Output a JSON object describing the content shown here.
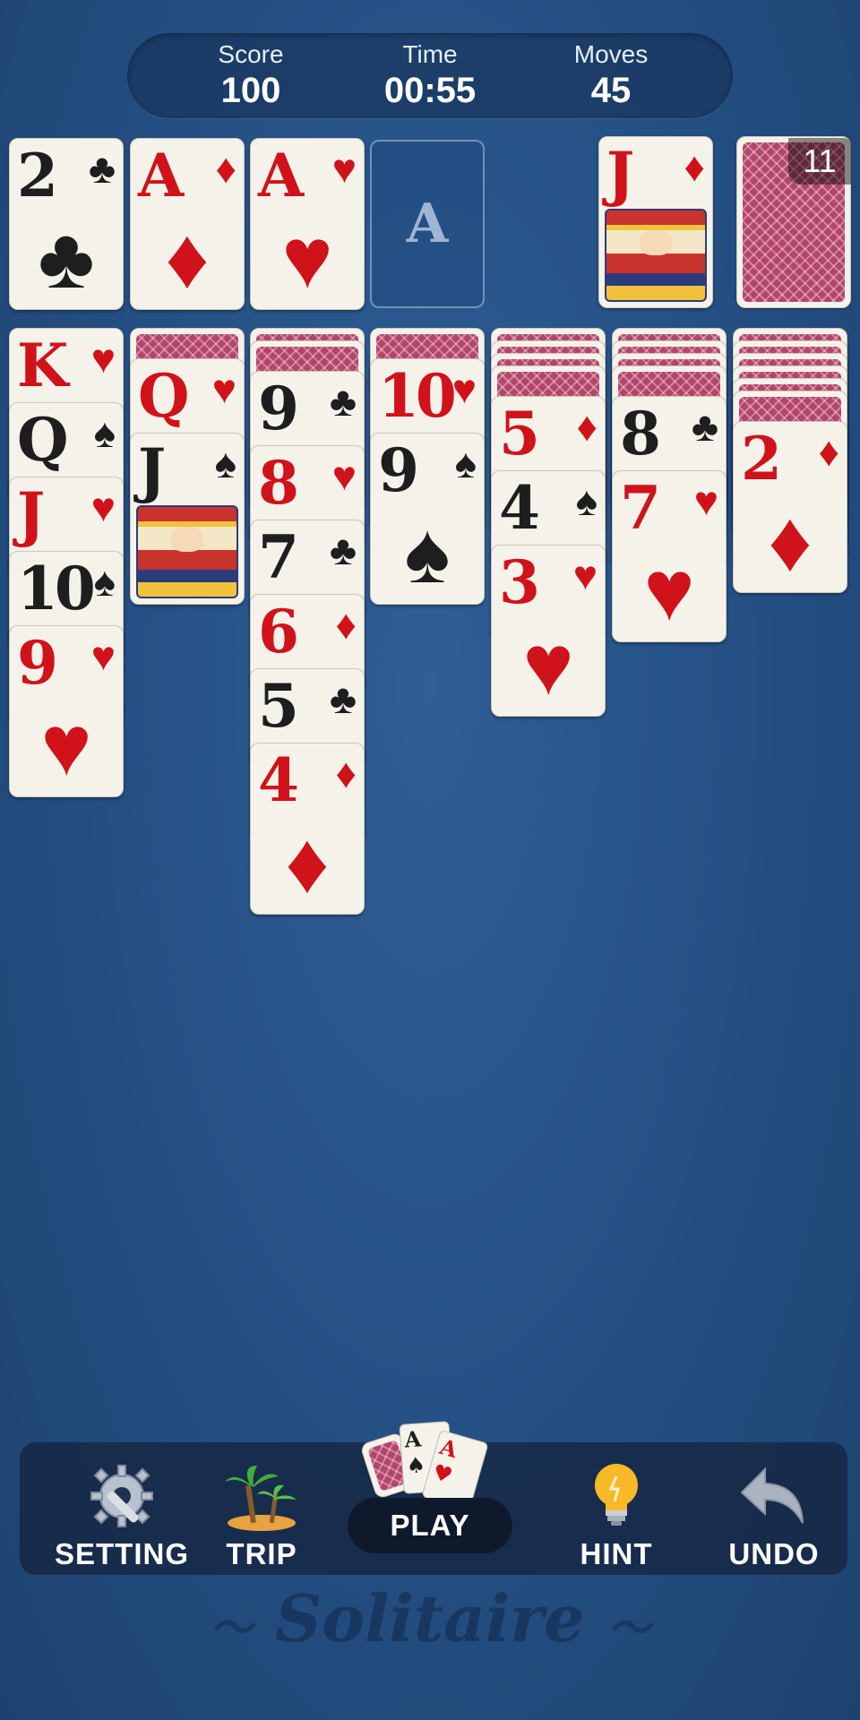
{
  "stats": {
    "score_label": "Score",
    "score": "100",
    "time_label": "Time",
    "time": "00:55",
    "moves_label": "Moves",
    "moves": "45"
  },
  "foundations": [
    {
      "rank": "2",
      "suit": "♣",
      "color": "black"
    },
    {
      "rank": "A",
      "suit": "♦",
      "color": "red"
    },
    {
      "rank": "A",
      "suit": "♥",
      "color": "red"
    },
    {
      "rank": "A",
      "suit": "",
      "color": "empty"
    }
  ],
  "waste": {
    "rank": "J",
    "suit": "♦",
    "color": "red"
  },
  "stock": {
    "count": "11"
  },
  "tableau": [
    {
      "hidden": 0,
      "cards": [
        {
          "rank": "K",
          "suit": "♥",
          "color": "red"
        },
        {
          "rank": "Q",
          "suit": "♠",
          "color": "black"
        },
        {
          "rank": "J",
          "suit": "♥",
          "color": "red"
        },
        {
          "rank": "10",
          "suit": "♠",
          "color": "black"
        },
        {
          "rank": "9",
          "suit": "♥",
          "color": "red"
        }
      ]
    },
    {
      "hidden": 1,
      "cards": [
        {
          "rank": "Q",
          "suit": "♥",
          "color": "red"
        },
        {
          "rank": "J",
          "suit": "♠",
          "color": "black"
        }
      ]
    },
    {
      "hidden": 2,
      "cards": [
        {
          "rank": "9",
          "suit": "♣",
          "color": "black"
        },
        {
          "rank": "8",
          "suit": "♥",
          "color": "red"
        },
        {
          "rank": "7",
          "suit": "♣",
          "color": "black"
        },
        {
          "rank": "6",
          "suit": "♦",
          "color": "red"
        },
        {
          "rank": "5",
          "suit": "♣",
          "color": "black"
        },
        {
          "rank": "4",
          "suit": "♦",
          "color": "red"
        }
      ]
    },
    {
      "hidden": 1,
      "cards": [
        {
          "rank": "10",
          "suit": "♥",
          "color": "red"
        },
        {
          "rank": "9",
          "suit": "♠",
          "color": "black"
        }
      ]
    },
    {
      "hidden": 4,
      "cards": [
        {
          "rank": "5",
          "suit": "♦",
          "color": "red"
        },
        {
          "rank": "4",
          "suit": "♠",
          "color": "black"
        },
        {
          "rank": "3",
          "suit": "♥",
          "color": "red"
        }
      ]
    },
    {
      "hidden": 4,
      "cards": [
        {
          "rank": "8",
          "suit": "♣",
          "color": "black"
        },
        {
          "rank": "7",
          "suit": "♥",
          "color": "red"
        }
      ]
    },
    {
      "hidden": 6,
      "cards": [
        {
          "rank": "2",
          "suit": "♦",
          "color": "red"
        }
      ]
    }
  ],
  "toolbar": {
    "setting": "SETTING",
    "trip": "TRIP",
    "play": "PLAY",
    "hint": "HINT",
    "undo": "UNDO"
  },
  "play_cards": {
    "card1": "A",
    "card2": "A"
  },
  "logo": "Solitaire",
  "colors": {
    "red": "#d0121b",
    "black": "#1e1e1e",
    "felt": "#244f83",
    "card_back": "#b5446a"
  }
}
